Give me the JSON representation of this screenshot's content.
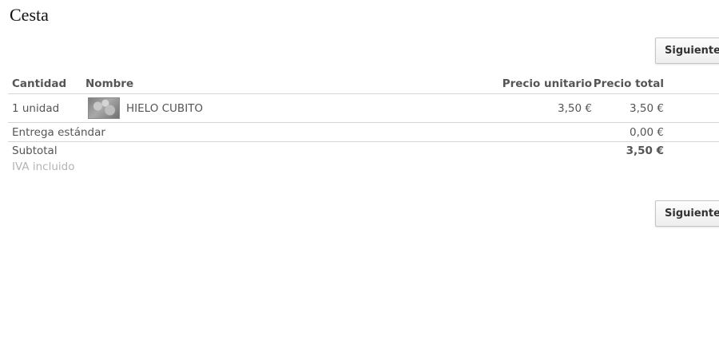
{
  "page": {
    "title": "Cesta"
  },
  "buttons": {
    "next_label": "Siguiente"
  },
  "cart": {
    "columns": {
      "quantity": "Cantidad",
      "name": "Nombre",
      "unit_price": "Precio unitario",
      "total_price": "Precio total"
    },
    "items": [
      {
        "quantity": "1 unidad",
        "image_icon": "product-photo-icon",
        "name": "HIELO CUBITO",
        "unit_price": "3,50 €",
        "total_price": "3,50 €"
      }
    ],
    "delivery": {
      "label": "Entrega estándar",
      "price": "0,00 €"
    },
    "subtotal": {
      "label": "Subtotal",
      "value": "3,50 €"
    },
    "tax_note": "IVA incluido"
  }
}
